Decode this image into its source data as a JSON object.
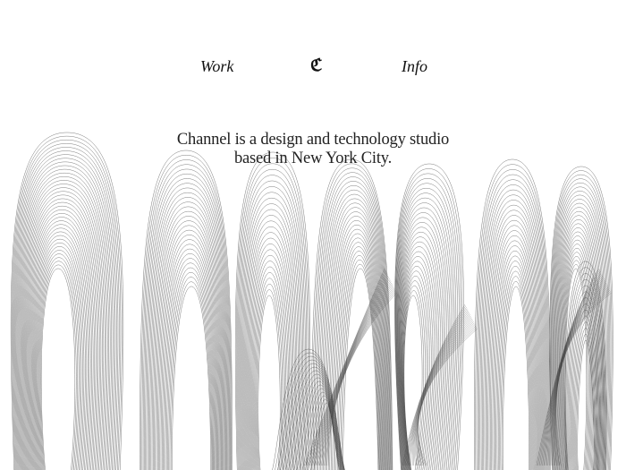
{
  "nav": {
    "work_label": "Work",
    "logo_glyph": "ℭ",
    "info_label": "Info"
  },
  "hero": {
    "line1": "Channel is a design and technology studio",
    "line2": "based in New York City."
  },
  "colors": {
    "background": "#ffffff",
    "text": "#1a1a1a",
    "line_art": "#3a3a3a"
  }
}
